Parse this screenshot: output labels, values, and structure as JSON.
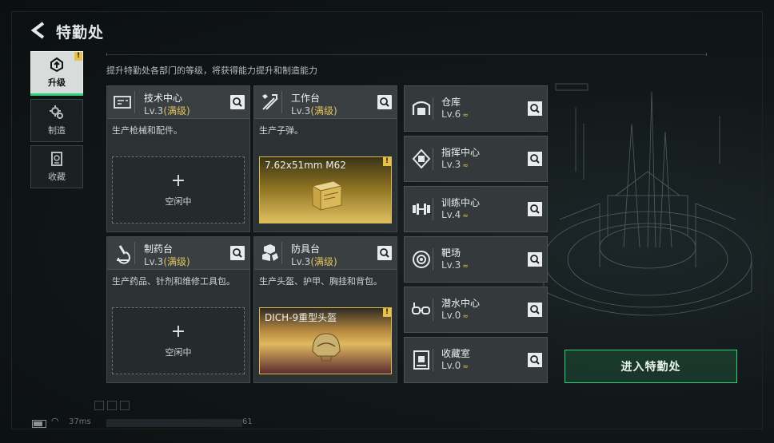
{
  "header": {
    "title": "特勤处",
    "subtitle": "提升特勤处各部门的等级，将获得能力提升和制造能力"
  },
  "tabs": [
    {
      "label": "升级",
      "icon": "upgrade-icon",
      "active": true,
      "badge": "!"
    },
    {
      "label": "制造",
      "icon": "gears-icon",
      "active": false
    },
    {
      "label": "收藏",
      "icon": "collection-icon",
      "active": false
    }
  ],
  "cards": [
    {
      "name": "技术中心",
      "level": "Lv.3",
      "max": "(满级)",
      "icon": "tech-center-icon",
      "desc": "生产枪械和配件。",
      "slot": {
        "type": "idle",
        "plus": "+",
        "label": "空闲中"
      }
    },
    {
      "name": "工作台",
      "level": "Lv.3",
      "max": "(满级)",
      "icon": "hammer-wrench-icon",
      "desc": "生产子弹。",
      "slot": {
        "type": "product",
        "name": "7.62x51mm M62",
        "badge": "!"
      }
    },
    {
      "name": "制药台",
      "level": "Lv.3",
      "max": "(满级)",
      "icon": "microscope-icon",
      "desc": "生产药品、针剂和维修工具包。",
      "slot": {
        "type": "idle",
        "plus": "+",
        "label": "空闲中"
      }
    },
    {
      "name": "防具台",
      "level": "Lv.3",
      "max": "(满级)",
      "icon": "armor-bench-icon",
      "desc": "生产头盔、护甲、胸挂和背包。",
      "slot": {
        "type": "product",
        "name": "DICH-9重型头盔",
        "badge": "!"
      }
    }
  ],
  "rooms": [
    {
      "name": "仓库",
      "level": "Lv.6",
      "icon": "warehouse-icon"
    },
    {
      "name": "指挥中心",
      "level": "Lv.3",
      "icon": "command-center-icon"
    },
    {
      "name": "训练中心",
      "level": "Lv.4",
      "icon": "dumbbell-icon"
    },
    {
      "name": "靶场",
      "level": "Lv.3",
      "icon": "target-icon"
    },
    {
      "name": "潜水中心",
      "level": "Lv.0",
      "icon": "diving-mask-icon"
    },
    {
      "name": "收藏室",
      "level": "Lv.0",
      "icon": "display-case-icon"
    }
  ],
  "level_up_glyph": "≈",
  "enter_button": "进入特勤处",
  "status": {
    "ping": "37ms",
    "uid_suffix": "61"
  },
  "colors": {
    "accent_green": "#2fd07a",
    "gold": "#e3c25e",
    "panel": "#2c3233"
  }
}
